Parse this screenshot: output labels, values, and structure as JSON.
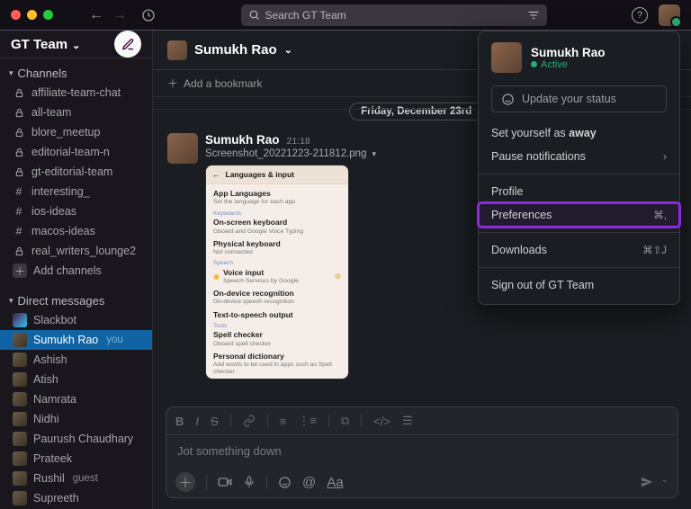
{
  "topbar": {
    "search_placeholder": "Search GT Team"
  },
  "workspace": {
    "name": "GT Team"
  },
  "sidebar": {
    "channels_header": "Channels",
    "channels": [
      {
        "name": "affiliate-team-chat",
        "private": true
      },
      {
        "name": "all-team",
        "private": true
      },
      {
        "name": "blore_meetup",
        "private": true
      },
      {
        "name": "editorial-team-n",
        "private": true
      },
      {
        "name": "gt-editorial-team",
        "private": true
      },
      {
        "name": "interesting_",
        "private": false
      },
      {
        "name": "ios-ideas",
        "private": false
      },
      {
        "name": "macos-ideas",
        "private": false
      },
      {
        "name": "real_writers_lounge2",
        "private": true
      }
    ],
    "add_channels": "Add channels",
    "dms_header": "Direct messages",
    "dms": [
      {
        "name": "Slackbot",
        "you": false,
        "guest": false,
        "slackbot": true
      },
      {
        "name": "Sumukh Rao",
        "you": true,
        "guest": false
      },
      {
        "name": "Ashish",
        "you": false,
        "guest": false
      },
      {
        "name": "Atish",
        "you": false,
        "guest": false
      },
      {
        "name": "Namrata",
        "you": false,
        "guest": false
      },
      {
        "name": "Nidhi",
        "you": false,
        "guest": false
      },
      {
        "name": "Paurush Chaudhary",
        "you": false,
        "guest": false
      },
      {
        "name": "Prateek",
        "you": false,
        "guest": false
      },
      {
        "name": "Rushil",
        "you": false,
        "guest": true
      },
      {
        "name": "Supreeth",
        "you": false,
        "guest": false
      }
    ],
    "you_label": "you",
    "guest_label": "guest"
  },
  "channel_header": {
    "title": "Sumukh Rao"
  },
  "bookmark": {
    "add": "Add a bookmark"
  },
  "date_divider": "Friday, December 23rd",
  "message": {
    "author": "Sumukh Rao",
    "time": "21:18",
    "filename": "Screenshot_20221223-211812.png",
    "attachment": {
      "title": "Languages & input",
      "app_languages": "App Languages",
      "app_languages_sub": "Set the language for each app",
      "label_keyboards": "Keyboards",
      "onscreen": "On-screen keyboard",
      "onscreen_sub": "Gboard and Google Voice Typing",
      "physical": "Physical keyboard",
      "physical_sub": "Not connected",
      "label_speech": "Speech",
      "voice_input": "Voice input",
      "voice_input_sub": "Speech Services by Google",
      "ondevice": "On-device recognition",
      "ondevice_sub": "On-device speech recognition",
      "tts": "Text-to-speech output",
      "label_tools": "Tools",
      "spell": "Spell checker",
      "spell_sub": "Gboard spell checker",
      "dict": "Personal dictionary",
      "dict_sub": "Add words to be used in apps such as Spell checker"
    }
  },
  "composer": {
    "placeholder": "Jot something down"
  },
  "user_menu": {
    "name": "Sumukh Rao",
    "status": "Active",
    "update_status": "Update your status",
    "set_away_prefix": "Set yourself as ",
    "set_away_bold": "away",
    "pause": "Pause notifications",
    "profile": "Profile",
    "preferences": "Preferences",
    "preferences_shortcut": "⌘,",
    "downloads": "Downloads",
    "downloads_shortcut": "⌘⇧J",
    "signout": "Sign out of GT Team"
  }
}
